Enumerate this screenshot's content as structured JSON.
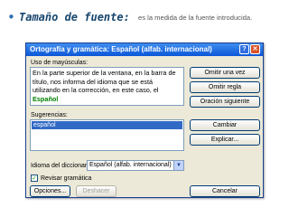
{
  "slide": {
    "bullet": "•",
    "heading": "Tamaño de fuente:",
    "description": "es la medida de la fuente introducida."
  },
  "dialog": {
    "title": "Ortografía y gramática: Español (alfab. internacional)",
    "help_icon_glyph": "?",
    "close_icon_glyph": "✕",
    "not_in_dictionary_label": "Uso de mayúsculas:",
    "text_before": "En la parte superior de la ventana, en la barra de título, nos informa del idioma que se está utilizando en la corrección, en este caso, el ",
    "highlighted_word": "Español",
    "suggestions_label": "Sugerencias:",
    "suggestions": [
      "español"
    ],
    "language_label": "Idioma del diccionario:",
    "language_value": "Español (alfab. internacional)",
    "dropdown_icon_glyph": "▼",
    "grammar_check_label": "Revisar gramática",
    "grammar_checked": true,
    "check_glyph": "✓",
    "buttons": {
      "ignore_once": "Omitir una vez",
      "ignore_rule": "Omitir regla",
      "next_sentence": "Oración siguiente",
      "change": "Cambiar",
      "explain": "Explicar...",
      "options": "Opciones...",
      "undo": "Deshacer",
      "cancel": "Cancelar"
    },
    "colors": {
      "title_bar": "#0b57d8",
      "highlight": "#008000",
      "selection": "#316ac5",
      "dialog_bg": "#ece9d8"
    }
  }
}
